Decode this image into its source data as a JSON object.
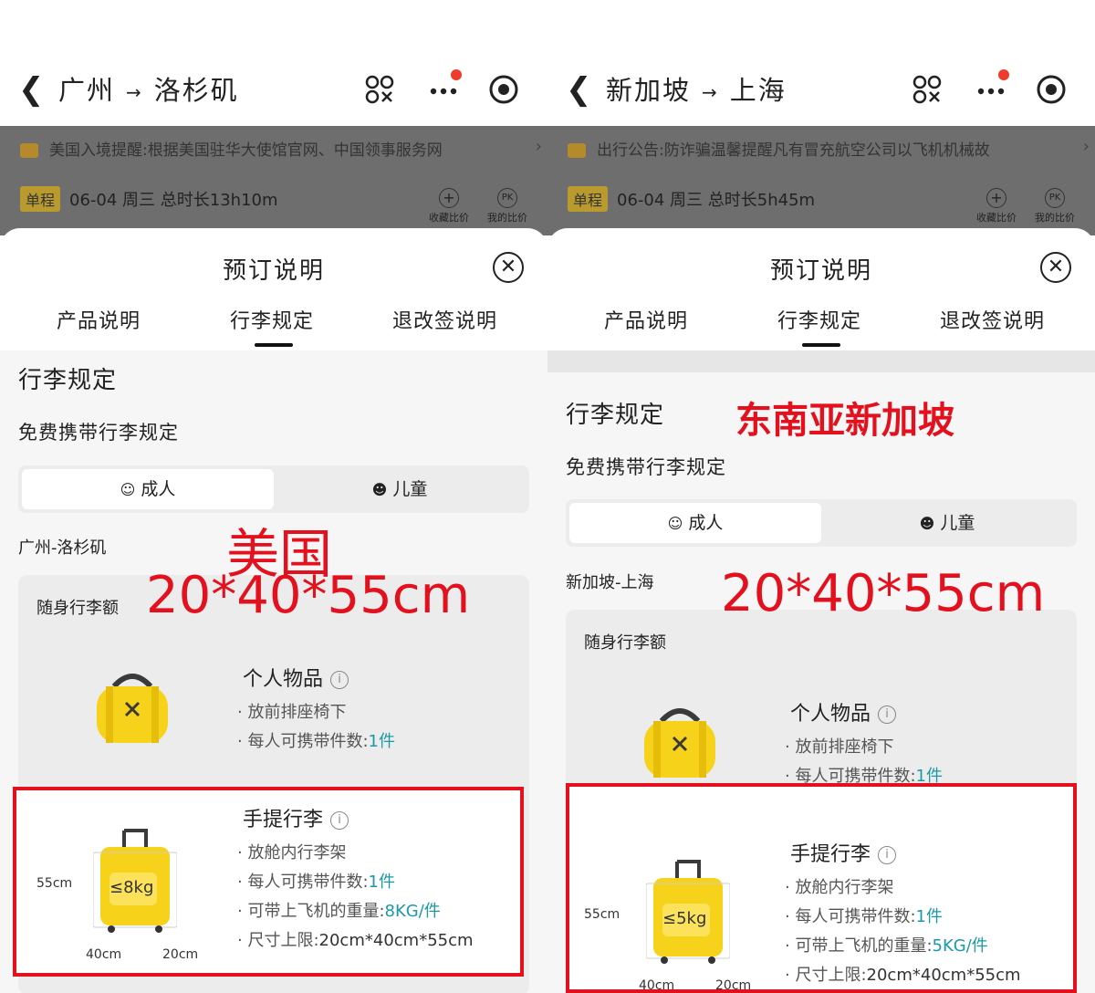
{
  "left": {
    "route_from": "广州",
    "route_to": "洛杉矶",
    "notice": "美国入境提醒:根据美国驻华大使馆官网、中国领事服务网",
    "trip_tag": "单程",
    "trip_info": "06-04 周三  总时长13h10m",
    "act_fav": "收藏比价",
    "act_mine": "我的比价",
    "sheet_title": "预订说明",
    "tabs": [
      "产品说明",
      "行李规定",
      "退改签说明"
    ],
    "section_title": "行李规定",
    "sub_title": "免费携带行李规定",
    "seg_adult": "成人",
    "seg_child": "儿童",
    "route_label": "广州-洛杉矶",
    "carry_label": "随身行李额",
    "personal": {
      "title": "个人物品",
      "l1": "放前排座椅下",
      "l2_prefix": "每人可携带件数:",
      "l2_val": "1件"
    },
    "handbag": {
      "title": "手提行李",
      "l1": "放舱内行李架",
      "l2_prefix": "每人可携带件数:",
      "l2_val": "1件",
      "l3_prefix": "可带上飞机的重量:",
      "l3_val": "8KG/件",
      "l4_prefix": "尺寸上限:",
      "l4_val": "20cm*40cm*55cm",
      "tag": "≤8kg",
      "dim_h": "55cm",
      "dim_w": "40cm",
      "dim_d": "20cm"
    },
    "annot_country": "美国",
    "annot_size": "20*40*55cm"
  },
  "right": {
    "route_from": "新加坡",
    "route_to": "上海",
    "notice": "出行公告:防诈骗温馨提醒凡有冒充航空公司以飞机机械故",
    "trip_tag": "单程",
    "trip_info": "06-04 周三  总时长5h45m",
    "act_fav": "收藏比价",
    "act_mine": "我的比价",
    "sheet_title": "预订说明",
    "tabs": [
      "产品说明",
      "行李规定",
      "退改签说明"
    ],
    "section_title": "行李规定",
    "sub_title": "免费携带行李规定",
    "seg_adult": "成人",
    "seg_child": "儿童",
    "route_label": "新加坡-上海",
    "carry_label": "随身行李额",
    "personal": {
      "title": "个人物品",
      "l1": "放前排座椅下",
      "l2_prefix": "每人可携带件数:",
      "l2_val": "1件"
    },
    "handbag": {
      "title": "手提行李",
      "l1": "放舱内行李架",
      "l2_prefix": "每人可携带件数:",
      "l2_val": "1件",
      "l3_prefix": "可带上飞机的重量:",
      "l3_val": "5KG/件",
      "l4_prefix": "尺寸上限:",
      "l4_val": "20cm*40cm*55cm",
      "tag": "≤5kg",
      "dim_h": "55cm",
      "dim_w": "40cm",
      "dim_d": "20cm"
    },
    "annot_region": "东南亚新加坡",
    "annot_size": "20*40*55cm"
  },
  "colors": {
    "annotation_red": "#e3111e",
    "accent_teal": "#1a9aa8",
    "bag_yellow": "#f7d21a"
  }
}
